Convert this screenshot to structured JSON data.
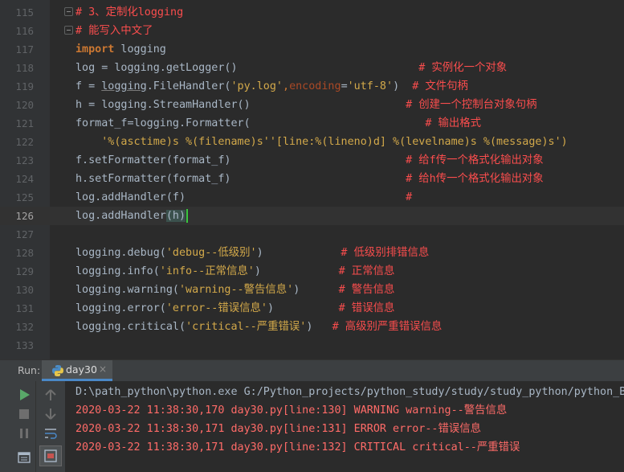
{
  "editor": {
    "lines": [
      {
        "n": "115",
        "parts": [
          {
            "t": "# 3、定制化logging",
            "c": "c-com"
          }
        ],
        "fold": "open"
      },
      {
        "n": "116",
        "parts": [
          {
            "t": "# 能写入中文了",
            "c": "c-com"
          }
        ],
        "fold": "open"
      },
      {
        "n": "117",
        "parts": [
          {
            "t": "import",
            "c": "c-kw"
          },
          {
            "t": " logging",
            "c": ""
          }
        ]
      },
      {
        "n": "118",
        "parts": [
          {
            "t": "log ",
            "c": ""
          },
          {
            "t": "=",
            "c": ""
          },
          {
            "t": " logging.getLogger()",
            "c": ""
          },
          {
            "t": "                            # 实例化一个对象",
            "c": "c-com"
          }
        ]
      },
      {
        "n": "119",
        "parts": [
          {
            "t": "f ",
            "c": ""
          },
          {
            "t": "=",
            "c": ""
          },
          {
            "t": " ",
            "c": ""
          },
          {
            "t": "logging",
            "c": "c-ul"
          },
          {
            "t": ".FileHandler(",
            "c": ""
          },
          {
            "t": "'py.log'",
            "c": "c-str2"
          },
          {
            "t": ",",
            "c": "c-eq"
          },
          {
            "t": "encoding",
            "c": "c-par"
          },
          {
            "t": "=",
            "c": ""
          },
          {
            "t": "'utf-8'",
            "c": "c-str2"
          },
          {
            "t": ")  ",
            "c": ""
          },
          {
            "t": "# 文件句柄",
            "c": "c-com"
          }
        ]
      },
      {
        "n": "120",
        "parts": [
          {
            "t": "h ",
            "c": ""
          },
          {
            "t": "=",
            "c": ""
          },
          {
            "t": " logging.StreamHandler()",
            "c": ""
          },
          {
            "t": "                        # 创建一个控制台对象句柄",
            "c": "c-com"
          }
        ]
      },
      {
        "n": "121",
        "parts": [
          {
            "t": "format_f",
            "c": ""
          },
          {
            "t": "=",
            "c": ""
          },
          {
            "t": "logging.Formatter(",
            "c": ""
          },
          {
            "t": "                           # 输出格式",
            "c": "c-com"
          }
        ]
      },
      {
        "n": "122",
        "parts": [
          {
            "t": "    '%(asctime)s %(filename)s''[line:%(lineno)d] %(levelname)s %(message)s')",
            "c": "c-str2"
          }
        ]
      },
      {
        "n": "123",
        "parts": [
          {
            "t": "f.setFormatter(format_f)",
            "c": ""
          },
          {
            "t": "                           # 给f传一个格式化输出对象",
            "c": "c-com"
          }
        ]
      },
      {
        "n": "124",
        "parts": [
          {
            "t": "h.setFormatter(format_f)",
            "c": ""
          },
          {
            "t": "                           # 给h传一个格式化输出对象",
            "c": "c-com"
          }
        ]
      },
      {
        "n": "125",
        "parts": [
          {
            "t": "log.addHandler(f)",
            "c": ""
          },
          {
            "t": "                                  #",
            "c": "c-com"
          }
        ]
      },
      {
        "n": "126",
        "parts": [
          {
            "t": "log.addHandler",
            "c": ""
          },
          {
            "t": "(h)",
            "c": "brace-hl"
          }
        ],
        "current": true
      },
      {
        "n": "127",
        "parts": []
      },
      {
        "n": "128",
        "parts": [
          {
            "t": "logging.debug(",
            "c": ""
          },
          {
            "t": "'debug--低级别'",
            "c": "c-str2"
          },
          {
            "t": ")",
            "c": ""
          },
          {
            "t": "            # 低级别排错信息",
            "c": "c-com"
          }
        ]
      },
      {
        "n": "129",
        "parts": [
          {
            "t": "logging.info(",
            "c": ""
          },
          {
            "t": "'info--正常信息'",
            "c": "c-str2"
          },
          {
            "t": ")",
            "c": ""
          },
          {
            "t": "            # 正常信息",
            "c": "c-com"
          }
        ]
      },
      {
        "n": "130",
        "parts": [
          {
            "t": "logging.warning(",
            "c": ""
          },
          {
            "t": "'warning--警告信息'",
            "c": "c-str2"
          },
          {
            "t": ")",
            "c": ""
          },
          {
            "t": "      # 警告信息",
            "c": "c-com"
          }
        ]
      },
      {
        "n": "131",
        "parts": [
          {
            "t": "logging.error(",
            "c": ""
          },
          {
            "t": "'error--错误信息'",
            "c": "c-str2"
          },
          {
            "t": ")",
            "c": ""
          },
          {
            "t": "          # 错误信息",
            "c": "c-com"
          }
        ]
      },
      {
        "n": "132",
        "parts": [
          {
            "t": "logging.critical(",
            "c": ""
          },
          {
            "t": "'critical--严重错误'",
            "c": "c-str2"
          },
          {
            "t": ")",
            "c": ""
          },
          {
            "t": "   # 高级别严重错误信息",
            "c": "c-com"
          }
        ]
      },
      {
        "n": "133",
        "parts": []
      }
    ]
  },
  "run": {
    "label": "Run:",
    "tab_label": "day30",
    "tab_close": "×",
    "output": [
      {
        "text": "D:\\path_python\\python.exe G:/Python_projects/python_study/study/study_python/python_Ba",
        "kind": "cmd"
      },
      {
        "text": "2020-03-22 11:38:30,170 day30.py[line:130] WARNING warning--警告信息",
        "kind": "err"
      },
      {
        "text": "2020-03-22 11:38:30,171 day30.py[line:131] ERROR error--错误信息",
        "kind": "err"
      },
      {
        "text": "2020-03-22 11:38:30,171 day30.py[line:132] CRITICAL critical--严重错误",
        "kind": "err"
      }
    ]
  },
  "colors": {
    "comment": "#fa4d4d",
    "keyword": "#cc7832",
    "string": "#d3a94a",
    "error_output": "#ff6b68",
    "caret": "#39c83f"
  }
}
